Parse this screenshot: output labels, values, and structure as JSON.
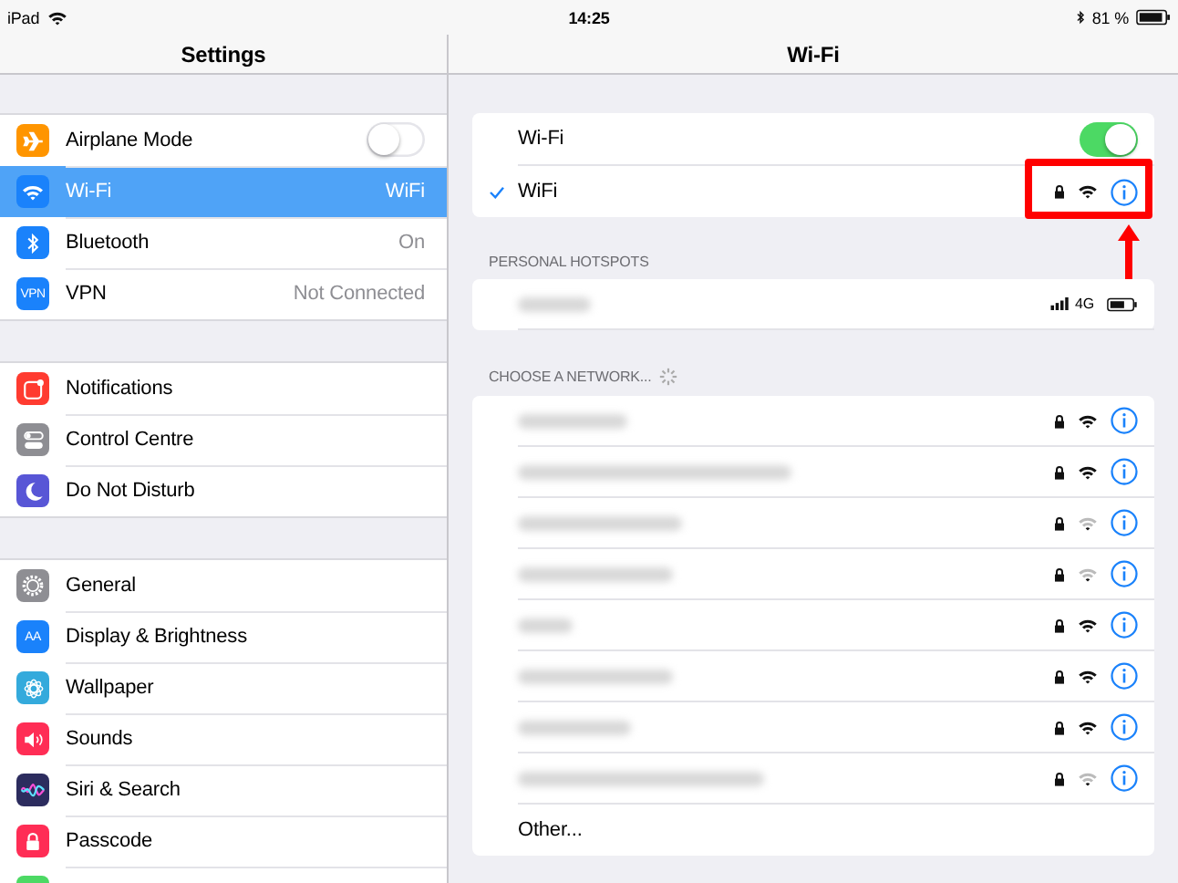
{
  "status_bar": {
    "device": "iPad",
    "time": "14:25",
    "battery": "81 %"
  },
  "sidebar": {
    "title": "Settings",
    "groups": [
      {
        "items": [
          {
            "label": "Airplane Mode",
            "color": "#ff9500",
            "kind": "toggle",
            "on": false,
            "selected": false
          },
          {
            "label": "Wi-Fi",
            "color": "#1a82fb",
            "kind": "value",
            "value": "WiFi",
            "selected": true
          },
          {
            "label": "Bluetooth",
            "color": "#1a82fb",
            "kind": "value",
            "value": "On",
            "selected": false
          },
          {
            "label": "VPN",
            "icon_text": "VPN",
            "color": "#1a82fb",
            "kind": "value",
            "value": "Not Connected",
            "selected": false
          }
        ]
      },
      {
        "items": [
          {
            "label": "Notifications",
            "color": "#ff3b30",
            "kind": "plain",
            "selected": false
          },
          {
            "label": "Control Centre",
            "color": "#8e8e93",
            "kind": "plain",
            "selected": false
          },
          {
            "label": "Do Not Disturb",
            "color": "#5856d6",
            "kind": "plain",
            "selected": false
          }
        ]
      },
      {
        "items": [
          {
            "label": "General",
            "color": "#8e8e93",
            "kind": "plain",
            "selected": false
          },
          {
            "label": "Display & Brightness",
            "icon_text": "AA",
            "color": "#1a82fb",
            "kind": "plain",
            "selected": false
          },
          {
            "label": "Wallpaper",
            "color": "#34aadc",
            "kind": "plain",
            "selected": false
          },
          {
            "label": "Sounds",
            "color": "#ff2d55",
            "kind": "plain",
            "selected": false
          },
          {
            "label": "Siri & Search",
            "color": "#2c2c5e",
            "kind": "plain",
            "selected": false
          },
          {
            "label": "Passcode",
            "color": "#ff2d55",
            "kind": "plain",
            "selected": false
          },
          {
            "color": "#4cd964",
            "kind": "plain",
            "selected": false
          }
        ]
      }
    ]
  },
  "detail": {
    "title": "Wi-Fi",
    "wifi_toggle": {
      "label": "Wi-Fi",
      "on": true
    },
    "connected": {
      "name": "WiFi",
      "secured": true,
      "weak_signal": false
    },
    "hotspots": {
      "header": "PERSONAL HOTSPOTS",
      "items": [
        {
          "network": "4G"
        }
      ]
    },
    "networks": {
      "header": "CHOOSE A NETWORK...",
      "items": [
        {
          "secured": true,
          "weak_signal": false
        },
        {
          "secured": true,
          "weak_signal": false
        },
        {
          "secured": true,
          "weak_signal": true
        },
        {
          "secured": true,
          "weak_signal": true
        },
        {
          "secured": true,
          "weak_signal": false
        },
        {
          "secured": true,
          "weak_signal": false
        },
        {
          "secured": true,
          "weak_signal": false
        },
        {
          "secured": true,
          "weak_signal": true
        }
      ],
      "other": "Other..."
    }
  }
}
